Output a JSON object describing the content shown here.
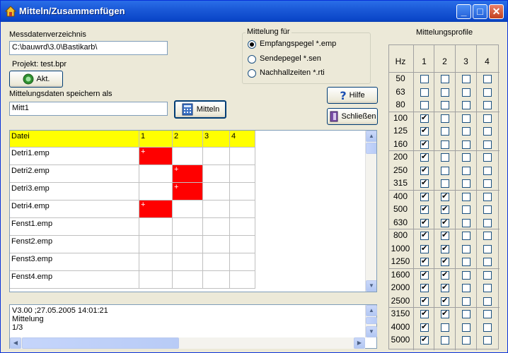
{
  "window": {
    "title": "Mitteln/Zusammenfügen",
    "minimize": "_",
    "maximize": "□",
    "close": "✕"
  },
  "left": {
    "dir_label": "Messdatenverzeichnis",
    "dir_value": "C:\\bauwrd\\3.0\\Bastikarb\\",
    "project_label": "Projekt: test.bpr",
    "akt_label": "Akt.",
    "save_label": "Mittelungsdaten speichern als",
    "save_value": "Mitt1",
    "mitteln_label": "Mitteln"
  },
  "mittelung": {
    "legend": "Mittelung für",
    "options": [
      "Empfangspegel *.emp",
      "Sendepegel *.sen",
      "Nachhallzeiten *.rti"
    ],
    "selected": 0
  },
  "buttons": {
    "hilfe": "Hilfe",
    "schliessen": "Schließen"
  },
  "grid": {
    "headers": [
      "Datei",
      "1",
      "2",
      "3",
      "4"
    ],
    "rows": [
      {
        "name": "Detri1.emp",
        "marks": [
          1,
          0,
          0,
          0
        ]
      },
      {
        "name": "Detri2.emp",
        "marks": [
          0,
          1,
          0,
          0
        ]
      },
      {
        "name": "Detri3.emp",
        "marks": [
          0,
          1,
          0,
          0
        ]
      },
      {
        "name": "Detri4.emp",
        "marks": [
          1,
          0,
          0,
          0
        ]
      },
      {
        "name": "Fenst1.emp",
        "marks": [
          0,
          0,
          0,
          0
        ]
      },
      {
        "name": "Fenst2.emp",
        "marks": [
          0,
          0,
          0,
          0
        ]
      },
      {
        "name": "Fenst3.emp",
        "marks": [
          0,
          0,
          0,
          0
        ]
      },
      {
        "name": "Fenst4.emp",
        "marks": [
          0,
          0,
          0,
          0
        ]
      }
    ],
    "mark_symbol": "+"
  },
  "log": {
    "lines": [
      "V3.00 ;27.05.2005 14:01:21",
      "Mittelung",
      "1/3"
    ]
  },
  "profiles": {
    "title": "Mittelungsprofile",
    "hz_label": "Hz",
    "cols": [
      "1",
      "2",
      "3",
      "4"
    ],
    "rows": [
      {
        "hz": "50",
        "checks": [
          0,
          0,
          0,
          0
        ]
      },
      {
        "hz": "63",
        "checks": [
          0,
          0,
          0,
          0
        ]
      },
      {
        "hz": "80",
        "checks": [
          0,
          0,
          0,
          0
        ]
      },
      {
        "hz": "100",
        "checks": [
          1,
          0,
          0,
          0
        ]
      },
      {
        "hz": "125",
        "checks": [
          1,
          0,
          0,
          0
        ]
      },
      {
        "hz": "160",
        "checks": [
          1,
          0,
          0,
          0
        ]
      },
      {
        "hz": "200",
        "checks": [
          1,
          0,
          0,
          0
        ]
      },
      {
        "hz": "250",
        "checks": [
          1,
          0,
          0,
          0
        ]
      },
      {
        "hz": "315",
        "checks": [
          1,
          0,
          0,
          0
        ]
      },
      {
        "hz": "400",
        "checks": [
          1,
          1,
          0,
          0
        ]
      },
      {
        "hz": "500",
        "checks": [
          1,
          1,
          0,
          0
        ]
      },
      {
        "hz": "630",
        "checks": [
          1,
          1,
          0,
          0
        ]
      },
      {
        "hz": "800",
        "checks": [
          1,
          1,
          0,
          0
        ]
      },
      {
        "hz": "1000",
        "checks": [
          1,
          1,
          0,
          0
        ]
      },
      {
        "hz": "1250",
        "checks": [
          1,
          1,
          0,
          0
        ]
      },
      {
        "hz": "1600",
        "checks": [
          1,
          1,
          0,
          0
        ]
      },
      {
        "hz": "2000",
        "checks": [
          1,
          1,
          0,
          0
        ]
      },
      {
        "hz": "2500",
        "checks": [
          1,
          1,
          0,
          0
        ]
      },
      {
        "hz": "3150",
        "checks": [
          1,
          1,
          0,
          0
        ]
      },
      {
        "hz": "4000",
        "checks": [
          1,
          0,
          0,
          0
        ]
      },
      {
        "hz": "5000",
        "checks": [
          1,
          0,
          0,
          0
        ]
      }
    ]
  }
}
